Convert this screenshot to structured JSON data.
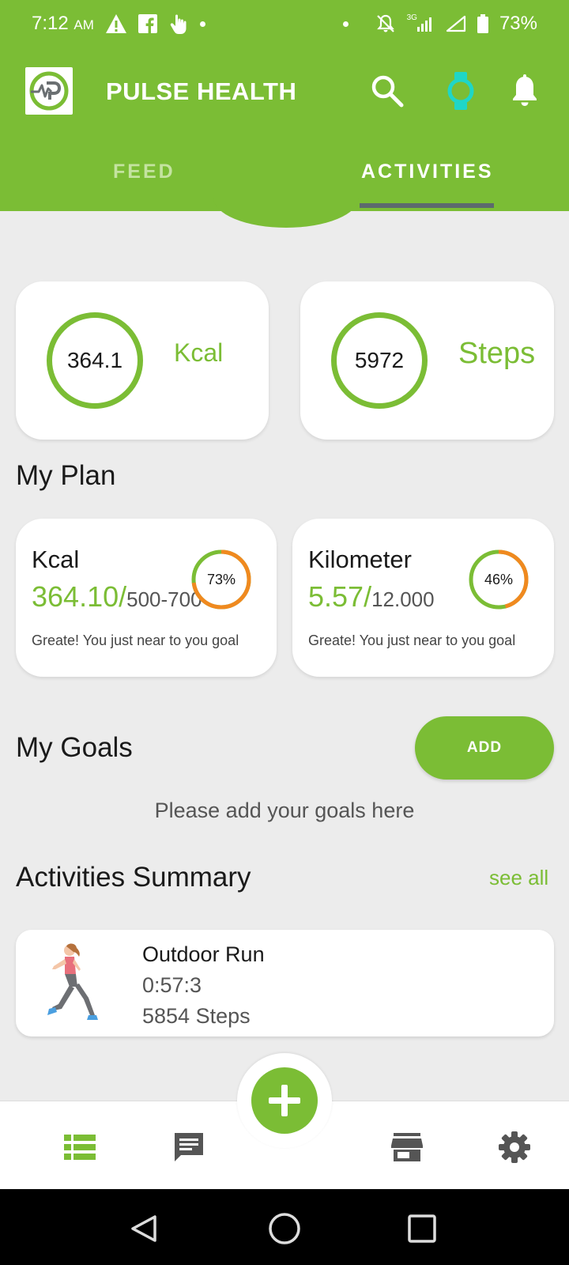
{
  "status_bar": {
    "time": "7:12",
    "ampm": "AM",
    "network": "3G",
    "battery": "73%"
  },
  "app_bar": {
    "title": "PULSE HEALTH"
  },
  "tabs": [
    {
      "label": "FEED",
      "active": false
    },
    {
      "label": "ACTIVITIES",
      "active": true
    }
  ],
  "stats": {
    "kcal": {
      "value": "364.1",
      "unit": "Kcal"
    },
    "steps": {
      "value": "5972",
      "unit": "Steps"
    }
  },
  "my_plan": {
    "title": "My Plan",
    "cards": [
      {
        "title": "Kcal",
        "current": "364.10/",
        "goal": "500-700",
        "percent_label": "73%",
        "percent": 73,
        "message": "Greate! You just near to you goal"
      },
      {
        "title": "Kilometer",
        "current": "5.57/",
        "goal": "12.000",
        "percent_label": "46%",
        "percent": 46,
        "message": "Greate! You just near to you goal"
      }
    ]
  },
  "my_goals": {
    "title": "My Goals",
    "add_label": "ADD",
    "empty_message": "Please add your goals here"
  },
  "activities_summary": {
    "title": "Activities Summary",
    "see_all_label": "see all",
    "items": [
      {
        "name": "Outdoor Run",
        "duration": "0:57:3",
        "steps": "5854 Steps",
        "icon": "runner-icon"
      }
    ]
  },
  "bottom_nav": {
    "items": [
      "list-icon",
      "chat-icon",
      "add-icon",
      "store-icon",
      "settings-icon"
    ]
  },
  "colors": {
    "brand_green": "#7bbd35",
    "ring_orange": "#f0891f",
    "watch_teal": "#1fd6c7"
  }
}
